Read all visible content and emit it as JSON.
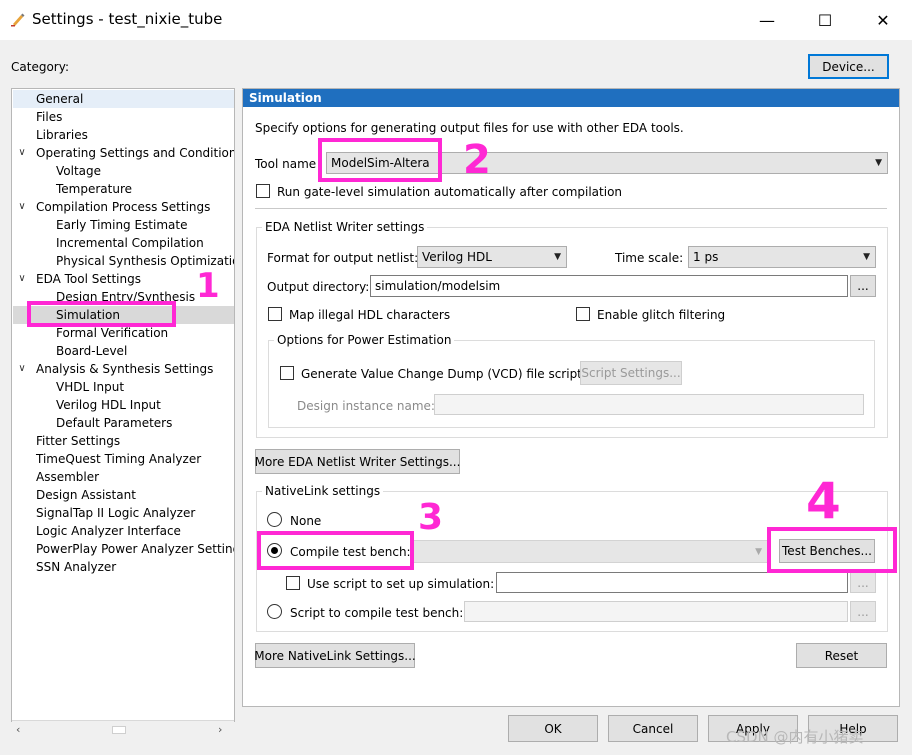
{
  "window": {
    "title": "Settings - test_nixie_tube",
    "minimize_glyph": "—",
    "maximize_glyph": "☐",
    "close_glyph": "✕"
  },
  "category_label": "Category:",
  "device_button": "Device...",
  "tree": [
    {
      "label": "General",
      "level": 0,
      "expander": false,
      "selected_bg": true
    },
    {
      "label": "Files",
      "level": 0,
      "expander": false
    },
    {
      "label": "Libraries",
      "level": 0,
      "expander": false
    },
    {
      "label": "Operating Settings and Conditions",
      "level": 0,
      "expander": true
    },
    {
      "label": "Voltage",
      "level": 1
    },
    {
      "label": "Temperature",
      "level": 1
    },
    {
      "label": "Compilation Process Settings",
      "level": 0,
      "expander": true
    },
    {
      "label": "Early Timing Estimate",
      "level": 1
    },
    {
      "label": "Incremental Compilation",
      "level": 1
    },
    {
      "label": "Physical Synthesis Optimization",
      "level": 1
    },
    {
      "label": "EDA Tool Settings",
      "level": 0,
      "expander": true
    },
    {
      "label": "Design Entry/Synthesis",
      "level": 1
    },
    {
      "label": "Simulation",
      "level": 1,
      "selected": true
    },
    {
      "label": "Formal Verification",
      "level": 1
    },
    {
      "label": "Board-Level",
      "level": 1
    },
    {
      "label": "Analysis & Synthesis Settings",
      "level": 0,
      "expander": true
    },
    {
      "label": "VHDL Input",
      "level": 1
    },
    {
      "label": "Verilog HDL Input",
      "level": 1
    },
    {
      "label": "Default Parameters",
      "level": 1
    },
    {
      "label": "Fitter Settings",
      "level": 0
    },
    {
      "label": "TimeQuest Timing Analyzer",
      "level": 0
    },
    {
      "label": "Assembler",
      "level": 0
    },
    {
      "label": "Design Assistant",
      "level": 0
    },
    {
      "label": "SignalTap II Logic Analyzer",
      "level": 0
    },
    {
      "label": "Logic Analyzer Interface",
      "level": 0
    },
    {
      "label": "PowerPlay Power Analyzer Settings",
      "level": 0
    },
    {
      "label": "SSN Analyzer",
      "level": 0
    }
  ],
  "panel": {
    "header": "Simulation",
    "description": "Specify options for generating output files for use with other EDA tools.",
    "tool_name_label": "Tool name",
    "tool_name_value": "ModelSim-Altera",
    "run_gate_level": "Run gate-level simulation automatically after compilation",
    "eda_group_title": "EDA Netlist Writer settings",
    "format_label": "Format for output netlist:",
    "format_value": "Verilog HDL",
    "timescale_label": "Time scale:",
    "timescale_value": "1 ps",
    "output_dir_label": "Output directory:",
    "output_dir_value": "simulation/modelsim",
    "browse": "...",
    "map_illegal": "Map illegal HDL characters",
    "glitch": "Enable glitch filtering",
    "power_group_title": "Options for Power Estimation",
    "gen_vcd": "Generate Value Change Dump (VCD) file script",
    "script_settings": "Script Settings...",
    "design_instance_label": "Design instance name:",
    "more_eda": "More EDA Netlist Writer Settings...",
    "nativelink_title": "NativeLink settings",
    "none": "None",
    "compile_tb": "Compile test bench:",
    "test_benches": "Test Benches...",
    "use_script": "Use script to set up simulation:",
    "script_compile": "Script to compile test bench:",
    "more_nativelink": "More NativeLink Settings...",
    "reset": "Reset"
  },
  "footer": {
    "ok": "OK",
    "cancel": "Cancel",
    "apply": "Apply",
    "help": "Help"
  },
  "annotations": {
    "n1": "1",
    "n2": "2",
    "n3": "3",
    "n4": "4",
    "highlight_color": "#ff28d4"
  },
  "watermark": "CSDN @内有小猪卖",
  "colors": {
    "header_blue": "#1f6fbf",
    "focus_blue": "#0078d7"
  }
}
